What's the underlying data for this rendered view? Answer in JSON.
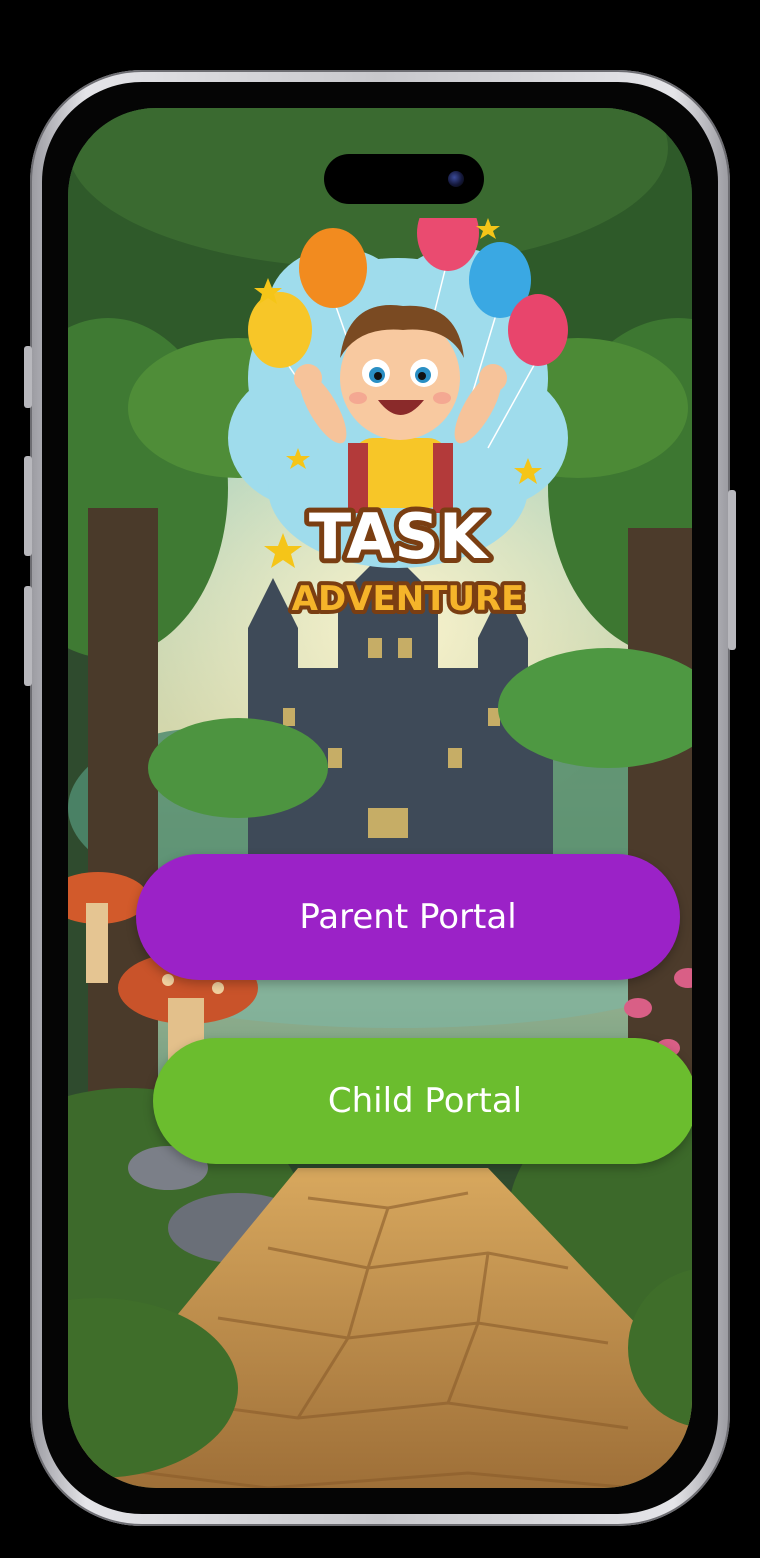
{
  "app": {
    "logo_title": "TASK",
    "logo_subtitle": "ADVENTURE"
  },
  "buttons": {
    "parent_label": "Parent Portal",
    "child_label": "Child Portal"
  },
  "colors": {
    "parent_button": "#9b22c7",
    "child_button": "#6bbd2e",
    "logo_text": "#f5a623"
  },
  "icons": {
    "logo": "task-adventure-logo",
    "camera": "front-camera-icon"
  }
}
